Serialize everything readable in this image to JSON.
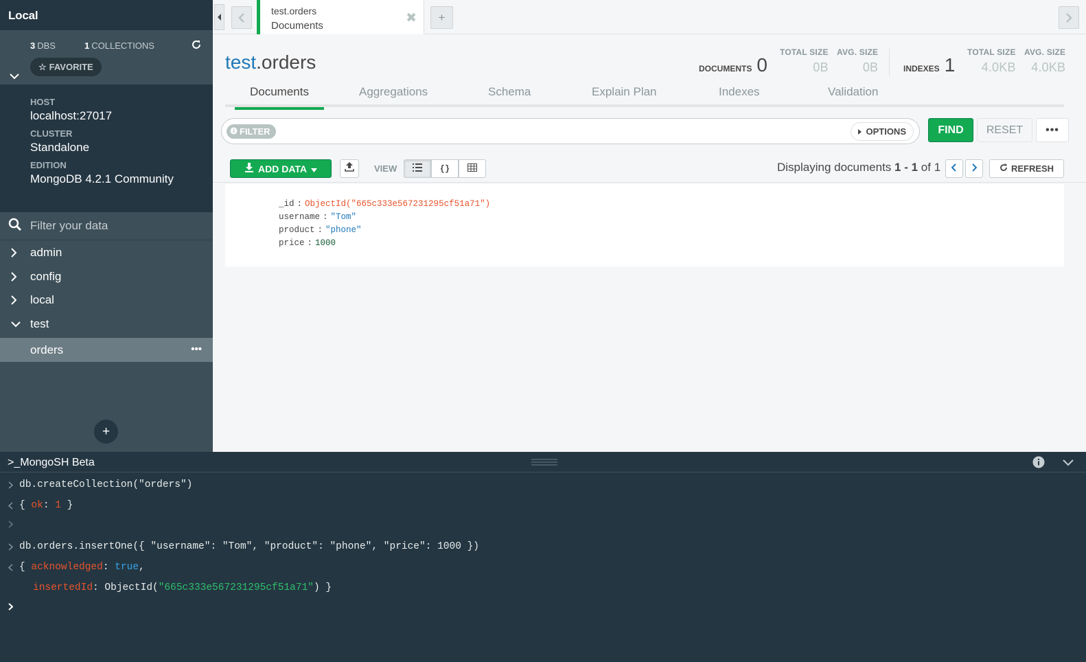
{
  "sidebar": {
    "title": "Local",
    "dbs_count": "3",
    "dbs_label": "DBS",
    "collections_count": "1",
    "collections_label": "COLLECTIONS",
    "favorite_label": "FAVORITE",
    "host_label": "HOST",
    "host_value": "localhost:27017",
    "cluster_label": "CLUSTER",
    "cluster_value": "Standalone",
    "edition_label": "EDITION",
    "edition_value": "MongoDB 4.2.1 Community",
    "filter_placeholder": "Filter your data",
    "databases": [
      {
        "name": "admin",
        "expanded": false
      },
      {
        "name": "config",
        "expanded": false
      },
      {
        "name": "local",
        "expanded": false
      },
      {
        "name": "test",
        "expanded": true
      }
    ],
    "active_collection": "orders",
    "add_button": "+"
  },
  "tabs": {
    "active_tab_namespace": "test.orders",
    "active_tab_subtitle": "Documents",
    "new_tab": "+"
  },
  "header": {
    "title_db": "test",
    "title_collection": ".orders",
    "documents_label": "DOCUMENTS",
    "documents_count": "0",
    "doc_total_size_label": "TOTAL SIZE",
    "doc_total_size": "0B",
    "doc_avg_size_label": "AVG. SIZE",
    "doc_avg_size": "0B",
    "indexes_label": "INDEXES",
    "indexes_count": "1",
    "idx_total_size_label": "TOTAL SIZE",
    "idx_total_size": "4.0KB",
    "idx_avg_size_label": "AVG. SIZE",
    "idx_avg_size": "4.0KB"
  },
  "subtabs": [
    "Documents",
    "Aggregations",
    "Schema",
    "Explain Plan",
    "Indexes",
    "Validation"
  ],
  "query": {
    "filter_label": "FILTER",
    "options_label": "OPTIONS",
    "find_label": "FIND",
    "reset_label": "RESET",
    "more_label": "•••"
  },
  "toolbar": {
    "add_data_label": "ADD DATA",
    "view_label": "VIEW",
    "display_prefix": "Displaying documents ",
    "display_range": "1 - 1",
    "display_of": " of ",
    "display_total": "1",
    "refresh_label": "REFRESH"
  },
  "document": [
    {
      "key": "_id",
      "value": "ObjectId(\"665c333e567231295cf51a71\")",
      "type": "oid"
    },
    {
      "key": "username",
      "value": "\"Tom\"",
      "type": "str"
    },
    {
      "key": "product",
      "value": "\"phone\"",
      "type": "str"
    },
    {
      "key": "price",
      "value": "1000",
      "type": "num"
    }
  ],
  "shell": {
    "title": ">_MongoSH Beta",
    "cmd1": "db.createCollection(\"orders\")",
    "res1_open": "{ ",
    "res1_key": "ok",
    "res1_sep": ": ",
    "res1_val": "1",
    "res1_close": " }",
    "cmd2": "db.orders.insertOne({ \"username\": \"Tom\", \"product\": \"phone\", \"price\": 1000 })",
    "res2_open": "{ ",
    "res2_key1": "acknowledged",
    "res2_sep1": ": ",
    "res2_val1": "true",
    "res2_comma": ",",
    "res2_key2": "insertedId",
    "res2_sep2": ": ObjectId(",
    "res2_val2": "\"665c333e567231295cf51a71\"",
    "res2_close": ") }"
  },
  "colors": {
    "accent_green": "#13aa52",
    "sidebar_bg": "#3d4f58",
    "sidebar_dark": "#243642",
    "db_blue": "#1f78b8",
    "oid_red": "#e7542b"
  }
}
